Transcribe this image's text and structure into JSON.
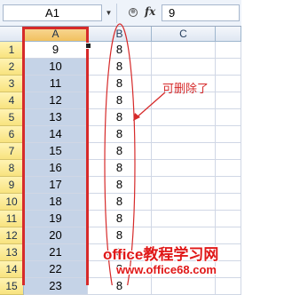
{
  "formula_bar": {
    "name_box": "A1",
    "formula_value": "9",
    "fx_label": "fx"
  },
  "columns": [
    "A",
    "B",
    "C"
  ],
  "rows": [
    {
      "num": "1",
      "a": "9",
      "b": "8"
    },
    {
      "num": "2",
      "a": "10",
      "b": "8"
    },
    {
      "num": "3",
      "a": "11",
      "b": "8"
    },
    {
      "num": "4",
      "a": "12",
      "b": "8"
    },
    {
      "num": "5",
      "a": "13",
      "b": "8"
    },
    {
      "num": "6",
      "a": "14",
      "b": "8"
    },
    {
      "num": "7",
      "a": "15",
      "b": "8"
    },
    {
      "num": "8",
      "a": "16",
      "b": "8"
    },
    {
      "num": "9",
      "a": "17",
      "b": "8"
    },
    {
      "num": "10",
      "a": "18",
      "b": "8"
    },
    {
      "num": "11",
      "a": "19",
      "b": "8"
    },
    {
      "num": "12",
      "a": "20",
      "b": "8"
    },
    {
      "num": "13",
      "a": "21",
      "b": "8"
    },
    {
      "num": "14",
      "a": "22",
      "b": "8"
    },
    {
      "num": "15",
      "a": "23",
      "b": "8"
    }
  ],
  "annotation": {
    "text": "可删除了",
    "color": "#d62a2a"
  },
  "watermark": {
    "line1": "office教程学习网",
    "line2": "www.office68.com"
  },
  "colors": {
    "selection_outline": "#d62a2a",
    "selected_cells": "#c5d3e7",
    "row_header": "#f8e37f"
  }
}
